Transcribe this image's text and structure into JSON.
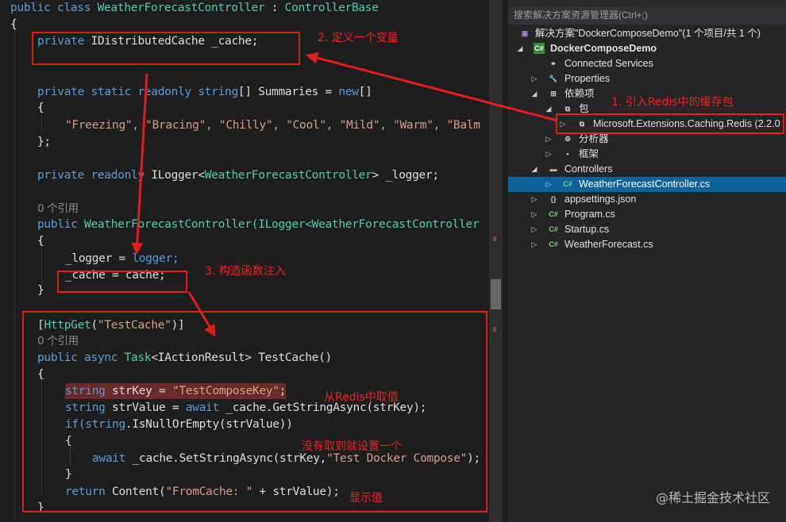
{
  "code": {
    "l1": {
      "a": "public class ",
      "b": "WeatherForecastController",
      "c": " : ",
      "d": "ControllerBase"
    },
    "l2": "{",
    "l3": {
      "a": "private ",
      "b": "IDistributedCache _cache;"
    },
    "l4": {
      "a": "private static readonly string",
      "b": "[] Summaries = ",
      "c": "new",
      "d": "[]"
    },
    "l5": "{",
    "l6": "\"Freezing\", \"Bracing\", \"Chilly\", \"Cool\", \"Mild\", \"Warm\", \"Balm",
    "l7": "};",
    "l8": {
      "a": "private readonly ",
      "b": "ILogger<",
      "c": "WeatherForecastController",
      "d": "> _logger;"
    },
    "l9": "0 个引用",
    "l10": {
      "a": "public ",
      "b": "WeatherForecastController(ILogger<",
      "c": "WeatherForecastController"
    },
    "l11": "{",
    "l12": {
      "a": "_logger = ",
      "b": "logger;"
    },
    "l13": {
      "a": "_cache = ",
      "b": "cache;"
    },
    "l14": "}",
    "l15": {
      "a": "[",
      "b": "HttpGet",
      "c": "(",
      "d": "\"TestCache\"",
      "e": ")]"
    },
    "l16": "0 个引用",
    "l17": {
      "a": "public async ",
      "b": "Task",
      "c": "<IActionResult> TestCache()"
    },
    "l18": "{",
    "l19": {
      "a": "string ",
      "b": "strKey = ",
      "c": "\"TestComposeKey\"",
      "d": ";"
    },
    "l20": {
      "a": "string ",
      "b": "strValue = ",
      "c": "await ",
      "d": "_cache.GetStringAsync(strKey);"
    },
    "l21": {
      "a": "if(",
      "b": "string",
      "c": ".IsNullOrEmpty(strValue))"
    },
    "l22": "{",
    "l23": {
      "a": "await ",
      "b": "_cache.SetStringAsync(strKey,",
      "c": "\"Test Docker Compose\"",
      "d": ");"
    },
    "l24": "}",
    "l25": {
      "a": "return ",
      "b": "Content(",
      "c": "\"FromCache: \"",
      "d": " + strValue);"
    },
    "l26": "}"
  },
  "solution_explorer": {
    "search_placeholder": "搜索解决方案资源管理器(Ctrl+;)",
    "items": [
      {
        "label": "解决方案\"DockerComposeDemo\"(1 个项目/共 1 个)",
        "icon": "solution-icon"
      },
      {
        "label": "DockerComposeDemo",
        "icon": "csharp-project-icon"
      },
      {
        "label": "Connected Services",
        "icon": "connected-services-icon"
      },
      {
        "label": "Properties",
        "icon": "wrench-icon"
      },
      {
        "label": "依赖项",
        "icon": "dependencies-icon"
      },
      {
        "label": "包",
        "icon": "package-icon"
      },
      {
        "label": "Microsoft.Extensions.Caching.Redis (2.2.0",
        "icon": "package-icon"
      },
      {
        "label": "分析器",
        "icon": "analyzer-icon"
      },
      {
        "label": "框架",
        "icon": "framework-icon"
      },
      {
        "label": "Controllers",
        "icon": "folder-icon"
      },
      {
        "label": "WeatherForecastController.cs",
        "icon": "csharp-file-icon"
      },
      {
        "label": "appsettings.json",
        "icon": "json-file-icon"
      },
      {
        "label": "Program.cs",
        "icon": "csharp-file-icon"
      },
      {
        "label": "Startup.cs",
        "icon": "csharp-file-icon"
      },
      {
        "label": "WeatherForecast.cs",
        "icon": "csharp-file-icon"
      }
    ]
  },
  "annotations": {
    "a1": "1. 引入Redis中的缓存包",
    "a2": "2. 定义一个变量",
    "a3": "3. 构造函数注入",
    "a4": "从Redis中取值",
    "a5": "没有取到就设置一个",
    "a6": "显示值"
  },
  "watermark": "@稀土掘金技术社区",
  "colors": {
    "annotation": "#e21b1b",
    "selection": "#0e639c",
    "keyword": "#569cd6",
    "type": "#4ec9b0",
    "string": "#d69d85"
  }
}
